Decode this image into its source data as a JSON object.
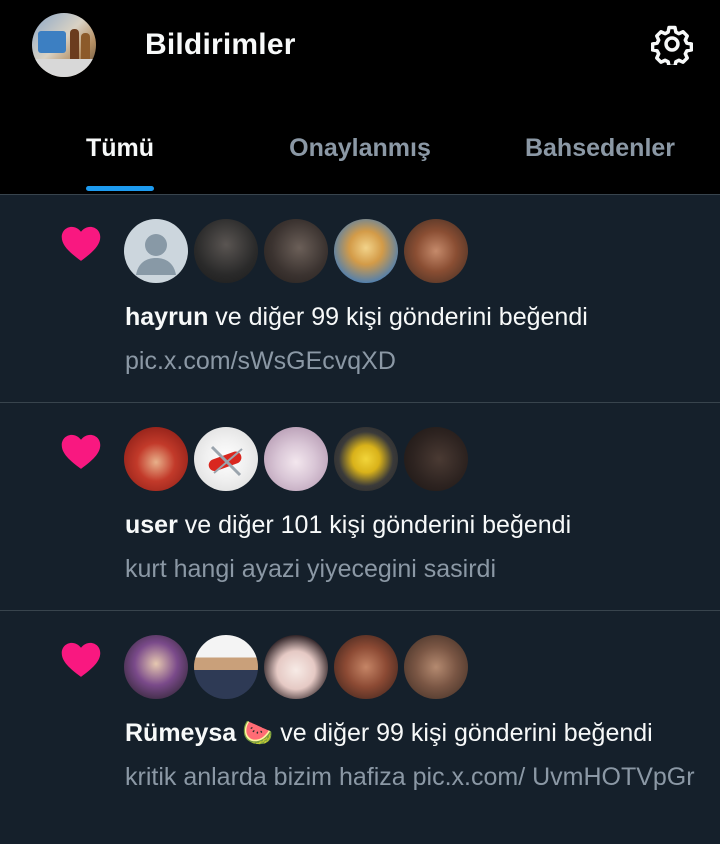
{
  "header": {
    "title": "Bildirimler",
    "profile_avatar": "profile-avatar",
    "settings_icon": "gear-icon"
  },
  "tabs": [
    {
      "label": "Tümü",
      "active": true
    },
    {
      "label": "Onaylanmış",
      "active": false
    },
    {
      "label": "Bahsedenler",
      "active": false
    }
  ],
  "notifications": [
    {
      "icon": "heart-icon",
      "user": "hayrun",
      "text": " ve diğer 99 kişi gönderini beğendi",
      "preview": "pic.x.com/sWsGEcvqXD"
    },
    {
      "icon": "heart-icon",
      "user": "user",
      "text": " ve diğer 101 kişi gönderini beğendi",
      "preview": "kurt hangi ayazi yiyecegini sasirdi"
    },
    {
      "icon": "heart-icon",
      "user": "Rümeysa",
      "emoji": "🍉",
      "text": " ve diğer 99 kişi gönderini beğendi",
      "preview": "kritik anlarda bizim hafiza pic.x.com/ UvmHOTVpGr"
    }
  ],
  "colors": {
    "background": "#15202b",
    "header_bg": "#000000",
    "accent": "#1d9bf0",
    "like": "#f91880",
    "text_primary": "#f7f9f9",
    "text_secondary": "#8b98a5",
    "divider": "#38444d"
  }
}
